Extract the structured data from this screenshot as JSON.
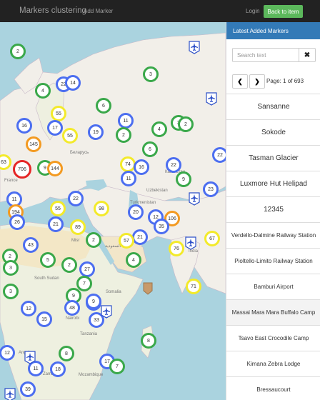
{
  "navbar": {
    "brand": "Markers clustering",
    "add_marker": "Add Marker",
    "login": "Login",
    "back_to_item": "Back to item"
  },
  "colors": {
    "navbar_bg": "#222222",
    "panel_header": "#337ab7",
    "back_button": "#5cb85c",
    "cluster_small": "#4c6ef0",
    "cluster_medium": "#3aa84a",
    "cluster_large": "#f3ea2a",
    "cluster_larger": "#f39a21",
    "cluster_largest": "#e52626"
  },
  "map": {
    "labels": [
      "Беларусь",
      "Казахстан",
      "Uzbekistan",
      "Turkmenistan",
      "France",
      "Misr",
      "South Sudan",
      "Somalia",
      "Nairobi",
      "Tanzania",
      "Angola",
      "Zambia",
      "Mozambique",
      "India",
      "السعودية"
    ],
    "clusters": [
      "2",
      "4",
      "22",
      "14",
      "3",
      "55",
      "6",
      "11",
      "3",
      "2",
      "16",
      "17",
      "55",
      "19",
      "2",
      "4",
      "6",
      "22",
      "145",
      "63",
      "706",
      "9",
      "144",
      "74",
      "16",
      "22",
      "9",
      "11",
      "11",
      "23",
      "22",
      "194",
      "55",
      "98",
      "20",
      "12",
      "106",
      "35",
      "26",
      "21",
      "89",
      "2",
      "21",
      "67",
      "43",
      "57",
      "76",
      "4",
      "2",
      "5",
      "2",
      "27",
      "3",
      "3",
      "7",
      "9",
      "3",
      "71",
      "12",
      "48",
      "9",
      "15",
      "33",
      "8",
      "12",
      "8",
      "17",
      "7",
      "11",
      "18",
      "39",
      "1",
      "16",
      "26",
      "8"
    ]
  },
  "panel": {
    "header": "Latest Added Markers",
    "search_placeholder": "Search text",
    "clear_icon": "times-icon",
    "prev_icon": "chevron-left-icon",
    "next_icon": "chevron-right-icon",
    "page_info": "Page: 1 of 693",
    "items": [
      "Sansanne",
      "Sokode",
      "Tasman Glacier",
      "Luxmore Hut Helipad",
      "12345",
      "Verdello-Dalmine Railway Station",
      "Pioltello-Limito Railway Station",
      "Bamburi Airport",
      "Massai Mara Mara Buffalo Camp",
      "Tsavo East Crocodile Camp",
      "Kimana Zebra Lodge",
      "Bressaucourt"
    ]
  }
}
